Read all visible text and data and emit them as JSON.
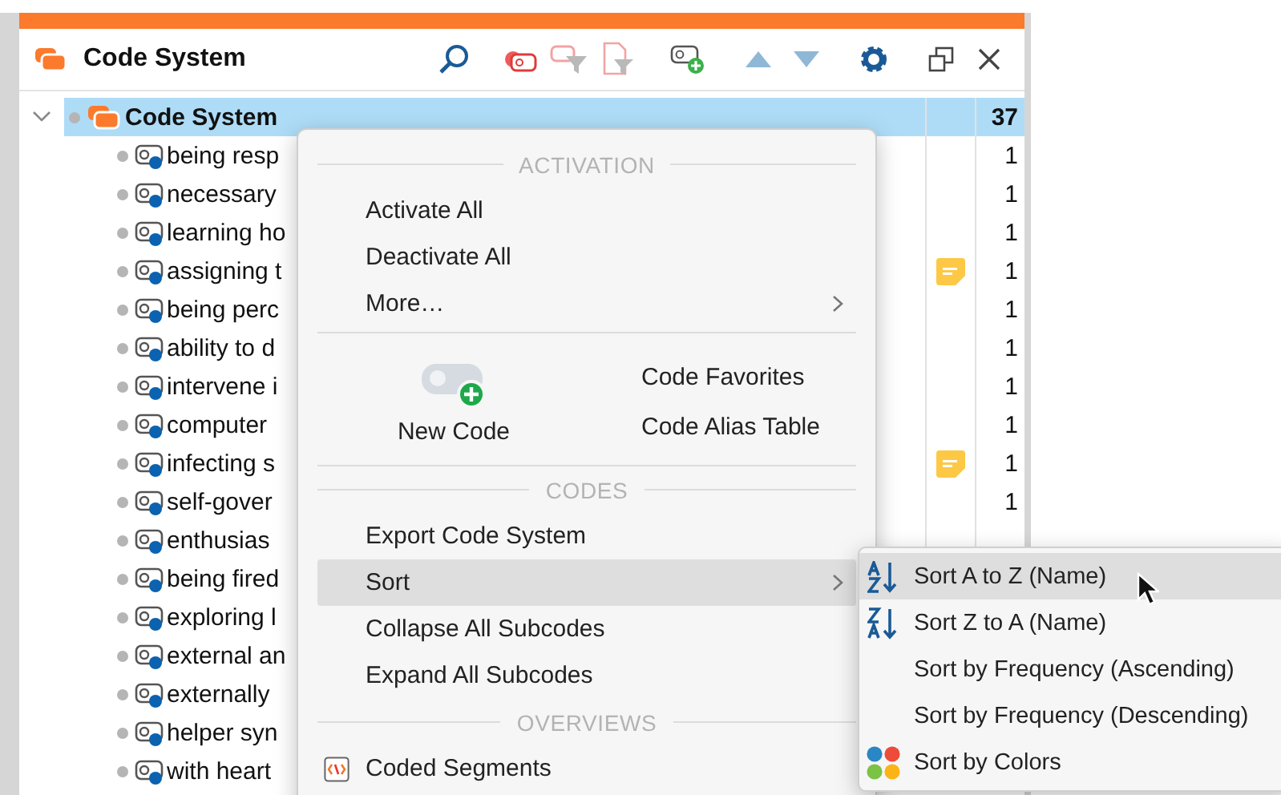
{
  "panel": {
    "title": "Code System"
  },
  "tree": {
    "root": {
      "label": "Code System",
      "count": "37",
      "expanded": true,
      "selected": true
    },
    "children": [
      {
        "label": "being resp",
        "count": "1",
        "memo": false
      },
      {
        "label": "necessary",
        "count": "1",
        "memo": false
      },
      {
        "label": "learning ho",
        "count": "1",
        "memo": false
      },
      {
        "label": "assigning t",
        "count": "1",
        "memo": true
      },
      {
        "label": "being perc",
        "count": "1",
        "memo": false
      },
      {
        "label": "ability to d",
        "count": "1",
        "memo": false
      },
      {
        "label": "intervene i",
        "count": "1",
        "memo": false
      },
      {
        "label": "computer",
        "count": "1",
        "memo": false
      },
      {
        "label": "infecting s",
        "count": "1",
        "memo": true
      },
      {
        "label": "self-gover",
        "count": "1",
        "memo": false
      },
      {
        "label": "enthusias",
        "memo": false
      },
      {
        "label": "being fired"
      },
      {
        "label": "exploring l"
      },
      {
        "label": "external an"
      },
      {
        "label": "externally"
      },
      {
        "label": "helper syn"
      },
      {
        "label": "with heart"
      }
    ]
  },
  "context_menu": {
    "items": [
      {
        "kind": "heading",
        "label": "ACTIVATION"
      },
      {
        "kind": "item",
        "label": "Activate All",
        "selected": false,
        "submenu": false
      },
      {
        "kind": "item",
        "label": "Deactivate All",
        "selected": false,
        "submenu": false
      },
      {
        "kind": "item",
        "label": "More…",
        "selected": false,
        "submenu": true
      },
      {
        "kind": "separator"
      },
      {
        "kind": "tiles",
        "tile": "New Code",
        "links": [
          "Code Favorites",
          "Code Alias Table"
        ]
      },
      {
        "kind": "heading",
        "label": "CODES"
      },
      {
        "kind": "item",
        "label": "Export Code System",
        "selected": false,
        "submenu": false
      },
      {
        "kind": "item",
        "label": "Sort",
        "selected": true,
        "submenu": true
      },
      {
        "kind": "item",
        "label": "Collapse All Subcodes",
        "selected": false,
        "submenu": false
      },
      {
        "kind": "item",
        "label": "Expand All Subcodes",
        "selected": false,
        "submenu": false
      },
      {
        "kind": "heading",
        "label": "OVERVIEWS"
      },
      {
        "kind": "segments",
        "label": "Coded Segments",
        "selected": false,
        "submenu": false
      }
    ]
  },
  "submenu": {
    "items": [
      {
        "label": "Sort A to Z (Name)",
        "kind": "az",
        "selected": true
      },
      {
        "label": "Sort Z to A (Name)",
        "kind": "za",
        "selected": false
      },
      {
        "label": "Sort by Frequency (Ascending)",
        "kind": "plain",
        "selected": false
      },
      {
        "label": "Sort by Frequency (Descending)",
        "kind": "plain",
        "selected": false
      },
      {
        "label": "Sort by Colors",
        "kind": "colors",
        "selected": false
      }
    ]
  }
}
